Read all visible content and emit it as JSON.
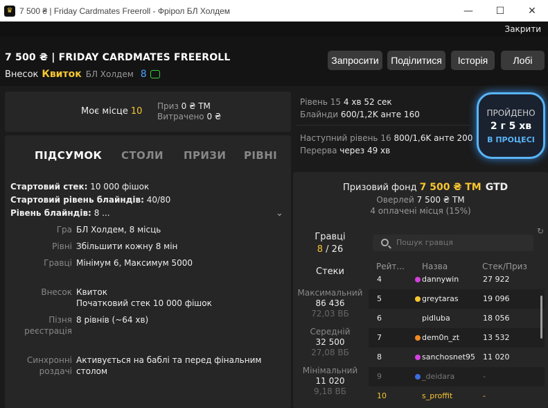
{
  "window": {
    "title": "7 500 ₴ | Friday Cardmates Freeroll - Фрірол БЛ Холдем",
    "minimize": "—",
    "maximize": "☐",
    "close": "✕",
    "logo": "♛"
  },
  "topbar": {
    "close_label": "Закрити"
  },
  "header": {
    "name": "7 500 ₴ | FRIDAY CARDMATES FREEROLL",
    "buyin_label": "Внесок",
    "ticket": "Квиток",
    "game": "БЛ Холдем",
    "count": "8",
    "buttons": [
      "Запросити",
      "Поділитися",
      "Історія",
      "Лобі"
    ]
  },
  "myplace": {
    "label": "Моє місце",
    "value": "10",
    "prize_label": "Приз",
    "prize_value": "0 ₴ ТМ",
    "spent_label": "Витрачено",
    "spent_value": "0 ₴"
  },
  "level": {
    "cur_label": "Рівень",
    "cur_num": "15",
    "cur_time": "4 хв 52 сек",
    "blinds_label": "Блайнди",
    "blinds_value": "600/1,2K анте 160",
    "next_label": "Наступний рівень",
    "next_num": "16",
    "next_value": "800/1,6K анте 200",
    "break_label": "Перерва",
    "break_value": "через 49 хв"
  },
  "timer": {
    "label": "ПРОЙДЕНО",
    "value": "2 г 5 хв",
    "status": "В ПРОЦЕСІ"
  },
  "tabs": [
    "ПІДСУМОК",
    "СТОЛИ",
    "ПРИЗИ",
    "РІВНІ"
  ],
  "summary": {
    "stack_k": "Стартовий стек:",
    "stack_v": "10 000 фішок",
    "blind_k": "Стартовий рівень блайндів:",
    "blind_v": "40/80",
    "level_k": "Рівень блайндів:",
    "level_v": "8 ...",
    "chevron": "⌄",
    "game_k": "Гра",
    "game_v": "БЛ Холдем, 8 місць",
    "levels_k": "Рівні",
    "levels_v": "Збільшити кожну 8 мін",
    "players_k": "Гравці",
    "players_v": "Мінімум 6, Максимум 5000",
    "buyin_k": "Внесок",
    "buyin_v1": "Квиток",
    "buyin_v2": "Початковий стек 10 000 фішок",
    "late_k1": "Пізня",
    "late_k2": "реєстрація",
    "late_v": "8 рівнів (~64 хв)",
    "sync_k1": "Синхронні",
    "sync_k2": "роздачі",
    "sync_v": "Активується на баблі та перед фінальним столом"
  },
  "prize": {
    "label": "Призовий фонд",
    "amount": "7 500 ₴ ТМ",
    "gtd": "GTD",
    "overlay_label": "Оверлей",
    "overlay_value": "7 500 ₴ ТМ",
    "paid": "4 оплачені місця (15%)"
  },
  "stats": {
    "players_label": "Гравці",
    "players_cur": "8",
    "players_total": "/ 26",
    "stacks_label": "Стеки",
    "max_label": "Максимальний",
    "max_value": "86 436",
    "max_bb": "72,03 ВБ",
    "avg_label": "Середній",
    "avg_value": "32 500",
    "avg_bb": "27,08 ВБ",
    "min_label": "Мінімальний",
    "min_value": "11 020",
    "min_bb": "9,18 ВБ"
  },
  "search": {
    "placeholder": "Пошук гравця",
    "refresh": "↻"
  },
  "table": {
    "headers": [
      "Рейт...",
      "Назва",
      "Стек/Приз"
    ],
    "rows": [
      {
        "rank": "4",
        "name": "dannywin",
        "stack": "27 922",
        "dot": "#d63fe0"
      },
      {
        "rank": "5",
        "name": "greytaras",
        "stack": "19 096",
        "dot": "#f7c631"
      },
      {
        "rank": "6",
        "name": "pidluba",
        "stack": "18 056",
        "dot": ""
      },
      {
        "rank": "7",
        "name": "dem0n_zt",
        "stack": "13 532",
        "dot": "#f08a24"
      },
      {
        "rank": "8",
        "name": "sanchosnet95",
        "stack": "11 020",
        "dot": "#d63fe0"
      },
      {
        "rank": "9",
        "name": "_deidara",
        "stack": "-",
        "dot": "#3b6fe0"
      },
      {
        "rank": "10",
        "name": "s_proffit",
        "stack": "-",
        "dot": ""
      }
    ]
  }
}
